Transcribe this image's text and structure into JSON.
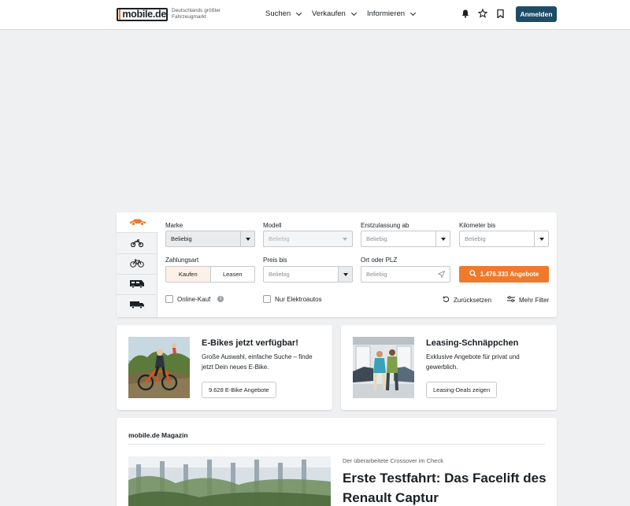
{
  "header": {
    "logo_text": "mobile.de",
    "tagline": "Deutschlands größter Fahrzeugmarkt",
    "nav": [
      {
        "label": "Suchen"
      },
      {
        "label": "Verkaufen"
      },
      {
        "label": "Informieren"
      }
    ],
    "icons": [
      "bell-icon",
      "star-icon",
      "bookmark-icon"
    ],
    "login_label": "Anmelden"
  },
  "search": {
    "vehicle_tabs": [
      "car-icon",
      "motorbike-icon",
      "bicycle-icon",
      "motorhome-icon",
      "truck-icon"
    ],
    "make": {
      "label": "Marke",
      "value": "Beliebig"
    },
    "model": {
      "label": "Modell",
      "value": "Beliebig"
    },
    "first_registration": {
      "label": "Erstzulassung ab",
      "value": "Beliebig"
    },
    "mileage": {
      "label": "Kilometer bis",
      "value": "Beliebig"
    },
    "payment": {
      "label": "Zahlungsart",
      "options": [
        "Kaufen",
        "Leasen"
      ],
      "selected": "Kaufen"
    },
    "price": {
      "label": "Preis bis",
      "value": "Beliebig"
    },
    "location": {
      "label": "Ort oder PLZ",
      "placeholder": "Beliebig"
    },
    "submit_label": "1.476.333 Angebote",
    "online_purchase_label": "Online-Kauf",
    "electric_only_label": "Nur Elektroautos",
    "reset_label": "Zurücksetzen",
    "more_filters_label": "Mehr Filter"
  },
  "promos": [
    {
      "title": "E-Bikes jetzt verfügbar!",
      "text": "Große Auswahl, einfache Suche – finde jetzt Dein neues E-Bike.",
      "button": "9.628 E-Bike Angebote"
    },
    {
      "title": "Leasing-Schnäppchen",
      "text": "Exklusive Angebote für privat und gewerblich.",
      "button": "Leasing-Deals zeigen"
    }
  ],
  "magazine": {
    "title": "mobile.de Magazin",
    "kicker": "Der überarbeitete Crossover im Check",
    "headline": "Erste Testfahrt: Das Facelift des Renault Captur"
  },
  "colors": {
    "accent": "#ef7a2c",
    "primary": "#1d4d66",
    "background": "#eff0f1"
  }
}
